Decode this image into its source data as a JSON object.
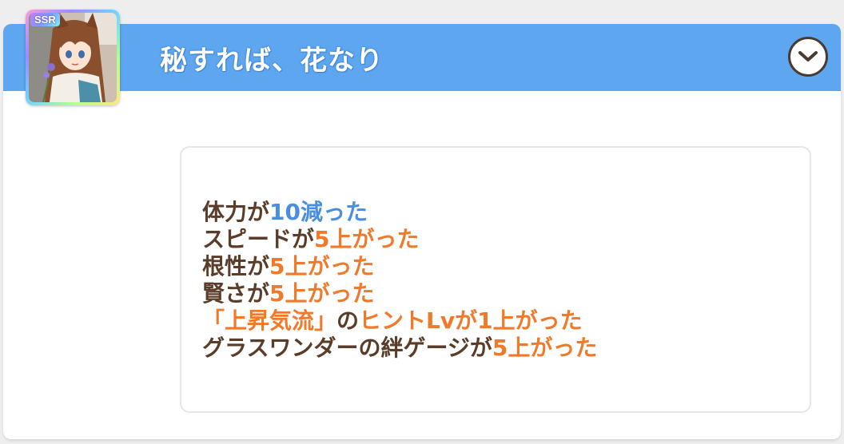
{
  "colors": {
    "header": "#5ea6f0",
    "text_brown": "#5a3c28",
    "value_blue": "#4a8ee0",
    "value_orange": "#f07a2a"
  },
  "card": {
    "rarity": "SSR",
    "icon": "character-portrait"
  },
  "header": {
    "title": "秘すれば、花なり",
    "toggle_icon": "chevron-down-icon"
  },
  "results": [
    {
      "prefix": "体力が",
      "value": "10減った",
      "suffix": "",
      "value_color": "blue"
    },
    {
      "prefix": "スピードが",
      "value": "5上がった",
      "suffix": "",
      "value_color": "orange"
    },
    {
      "prefix": "根性が",
      "value": "5上がった",
      "suffix": "",
      "value_color": "orange"
    },
    {
      "prefix": "賢さが",
      "value": "5上がった",
      "suffix": "",
      "value_color": "orange"
    },
    {
      "prefix": "「上昇気流」",
      "mid": "の",
      "value": "ヒントLvが1上がった",
      "value_color": "orange",
      "prefix_color": "orange"
    },
    {
      "prefix": "グラスワンダーの絆ゲージが",
      "value": "5上がった",
      "suffix": "",
      "value_color": "orange"
    }
  ]
}
